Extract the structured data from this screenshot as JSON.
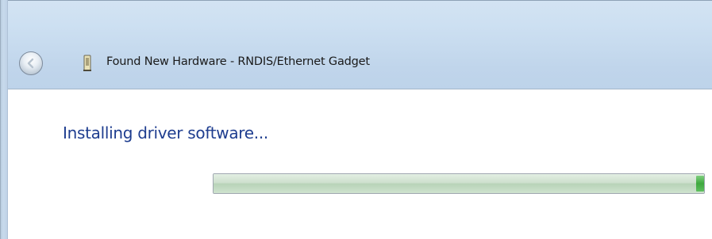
{
  "window": {
    "title": "Found New Hardware - RNDIS/Ethernet Gadget"
  },
  "icons": {
    "back": "back-arrow-icon",
    "hardware": "hardware-device-icon"
  },
  "content": {
    "heading": "Installing driver software...",
    "progress": {
      "fraction": 1.0
    }
  },
  "colors": {
    "heading": "#1e3d8f",
    "progress_accent": "#3ea83e"
  }
}
